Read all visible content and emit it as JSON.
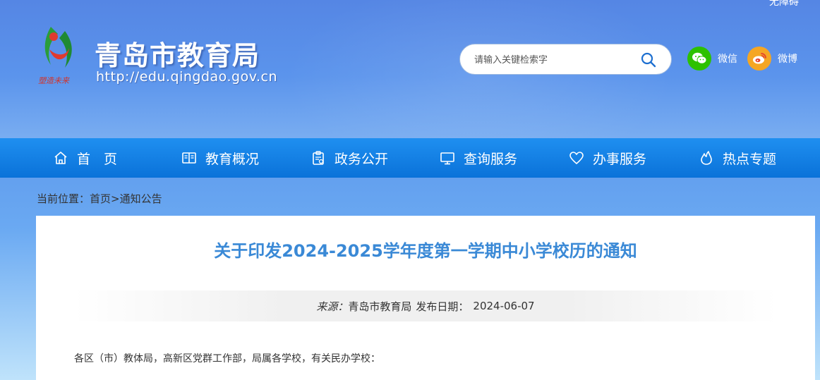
{
  "header": {
    "top_right_text": "无障碍",
    "site_title": "青岛市教育局",
    "site_url": "http://edu.qingdao.gov.cn",
    "logo_tagline": "塑造未来",
    "search": {
      "placeholder": "请输入关键检索字",
      "value": ""
    },
    "social": [
      {
        "label": "微信",
        "icon": "wechat-icon",
        "color": "#2dc100"
      },
      {
        "label": "微博",
        "icon": "weibo-icon",
        "color": "#f5a623"
      }
    ]
  },
  "nav": {
    "items": [
      {
        "label": "首　页",
        "icon": "home-icon"
      },
      {
        "label": "教育概况",
        "icon": "book-icon"
      },
      {
        "label": "政务公开",
        "icon": "clipboard-icon"
      },
      {
        "label": "查询服务",
        "icon": "monitor-icon"
      },
      {
        "label": "办事服务",
        "icon": "heart-icon"
      },
      {
        "label": "热点专题",
        "icon": "flame-icon"
      }
    ]
  },
  "breadcrumb": {
    "prefix": "当前位置：",
    "home": "首页",
    "separator": ">",
    "current": "通知公告"
  },
  "article": {
    "title": "关于印发2024-2025学年度第一学期中小学校历的通知",
    "source_label": "来源：",
    "source": "青岛市教育局",
    "date_label": "发布日期：",
    "date": "2024-06-07",
    "salutation": "各区（市）教体局，高新区党群工作部，局属各学校，有关民办学校："
  },
  "colors": {
    "nav_bg": "#0a72d9",
    "title": "#3a89d6",
    "header_bg": "#5b94ec"
  }
}
